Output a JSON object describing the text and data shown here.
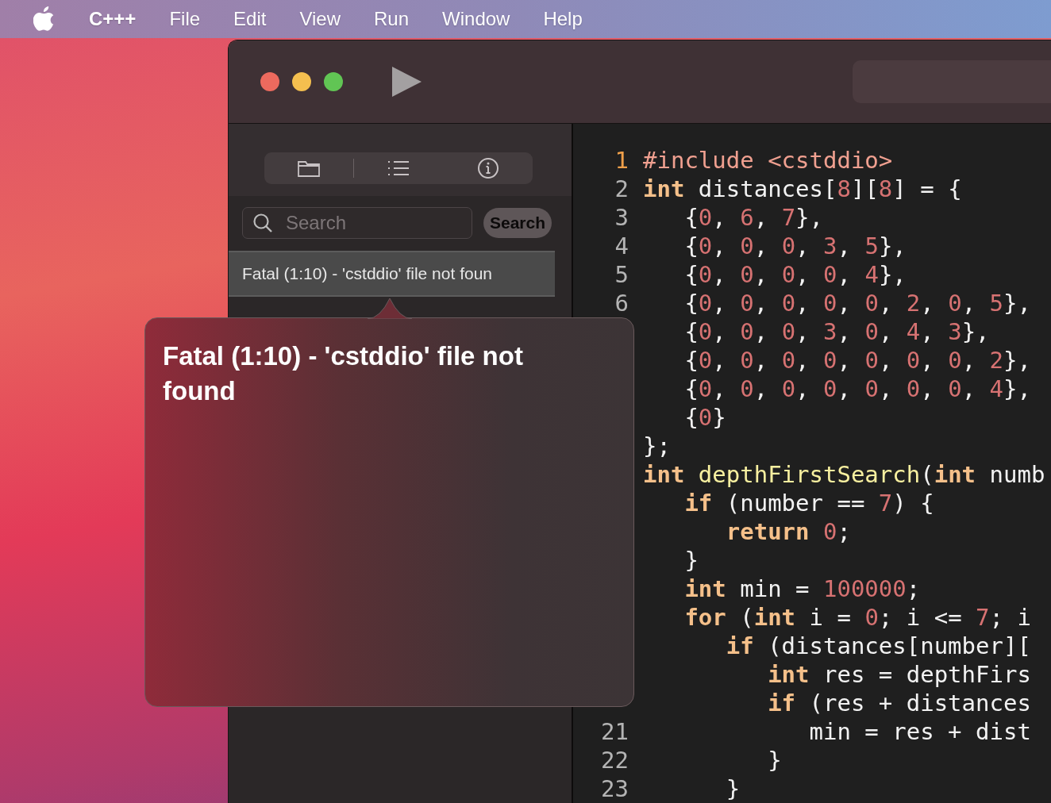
{
  "menu_bar": {
    "app": "C+++",
    "items": [
      "File",
      "Edit",
      "View",
      "Run",
      "Window",
      "Help"
    ]
  },
  "sidebar": {
    "search": {
      "placeholder": "Search",
      "button": "Search"
    },
    "issues": [
      {
        "text": "Fatal (1:10) - 'cstddio' file not foun",
        "selected": true
      }
    ]
  },
  "popover": {
    "message": "Fatal (1:10) - 'cstddio' file not found"
  },
  "editor": {
    "lines": [
      {
        "number": {
          "text": "1",
          "current": true
        },
        "tokens": [
          {
            "kind": "pre",
            "text": "#include <cstddio>"
          }
        ]
      },
      {
        "number": {
          "text": "2",
          "current": false
        },
        "tokens": [
          {
            "kind": "kw",
            "text": "int"
          },
          {
            "kind": "plain",
            "text": " distances["
          },
          {
            "kind": "num",
            "text": "8"
          },
          {
            "kind": "plain",
            "text": "]["
          },
          {
            "kind": "num",
            "text": "8"
          },
          {
            "kind": "plain",
            "text": "] = {"
          }
        ]
      },
      {
        "number": {
          "text": "3",
          "current": false
        },
        "tokens": [
          {
            "kind": "plain",
            "text": "   {"
          },
          {
            "kind": "num",
            "text": "0"
          },
          {
            "kind": "plain",
            "text": ", "
          },
          {
            "kind": "num",
            "text": "6"
          },
          {
            "kind": "plain",
            "text": ", "
          },
          {
            "kind": "num",
            "text": "7"
          },
          {
            "kind": "plain",
            "text": "},"
          }
        ]
      },
      {
        "number": {
          "text": "4",
          "current": false
        },
        "tokens": [
          {
            "kind": "plain",
            "text": "   {"
          },
          {
            "kind": "num",
            "text": "0"
          },
          {
            "kind": "plain",
            "text": ", "
          },
          {
            "kind": "num",
            "text": "0"
          },
          {
            "kind": "plain",
            "text": ", "
          },
          {
            "kind": "num",
            "text": "0"
          },
          {
            "kind": "plain",
            "text": ", "
          },
          {
            "kind": "num",
            "text": "3"
          },
          {
            "kind": "plain",
            "text": ", "
          },
          {
            "kind": "num",
            "text": "5"
          },
          {
            "kind": "plain",
            "text": "},"
          }
        ]
      },
      {
        "number": {
          "text": "5",
          "current": false
        },
        "tokens": [
          {
            "kind": "plain",
            "text": "   {"
          },
          {
            "kind": "num",
            "text": "0"
          },
          {
            "kind": "plain",
            "text": ", "
          },
          {
            "kind": "num",
            "text": "0"
          },
          {
            "kind": "plain",
            "text": ", "
          },
          {
            "kind": "num",
            "text": "0"
          },
          {
            "kind": "plain",
            "text": ", "
          },
          {
            "kind": "num",
            "text": "0"
          },
          {
            "kind": "plain",
            "text": ", "
          },
          {
            "kind": "num",
            "text": "4"
          },
          {
            "kind": "plain",
            "text": "},"
          }
        ]
      },
      {
        "number": {
          "text": "6",
          "current": false
        },
        "tokens": [
          {
            "kind": "plain",
            "text": "   {"
          },
          {
            "kind": "num",
            "text": "0"
          },
          {
            "kind": "plain",
            "text": ", "
          },
          {
            "kind": "num",
            "text": "0"
          },
          {
            "kind": "plain",
            "text": ", "
          },
          {
            "kind": "num",
            "text": "0"
          },
          {
            "kind": "plain",
            "text": ", "
          },
          {
            "kind": "num",
            "text": "0"
          },
          {
            "kind": "plain",
            "text": ", "
          },
          {
            "kind": "num",
            "text": "0"
          },
          {
            "kind": "plain",
            "text": ", "
          },
          {
            "kind": "num",
            "text": "2"
          },
          {
            "kind": "plain",
            "text": ", "
          },
          {
            "kind": "num",
            "text": "0"
          },
          {
            "kind": "plain",
            "text": ", "
          },
          {
            "kind": "num",
            "text": "5"
          },
          {
            "kind": "plain",
            "text": "},"
          }
        ]
      },
      {
        "tokens": [
          {
            "kind": "plain",
            "text": "   {"
          },
          {
            "kind": "num",
            "text": "0"
          },
          {
            "kind": "plain",
            "text": ", "
          },
          {
            "kind": "num",
            "text": "0"
          },
          {
            "kind": "plain",
            "text": ", "
          },
          {
            "kind": "num",
            "text": "0"
          },
          {
            "kind": "plain",
            "text": ", "
          },
          {
            "kind": "num",
            "text": "3"
          },
          {
            "kind": "plain",
            "text": ", "
          },
          {
            "kind": "num",
            "text": "0"
          },
          {
            "kind": "plain",
            "text": ", "
          },
          {
            "kind": "num",
            "text": "4"
          },
          {
            "kind": "plain",
            "text": ", "
          },
          {
            "kind": "num",
            "text": "3"
          },
          {
            "kind": "plain",
            "text": "},"
          }
        ]
      },
      {
        "tokens": [
          {
            "kind": "plain",
            "text": "   {"
          },
          {
            "kind": "num",
            "text": "0"
          },
          {
            "kind": "plain",
            "text": ", "
          },
          {
            "kind": "num",
            "text": "0"
          },
          {
            "kind": "plain",
            "text": ", "
          },
          {
            "kind": "num",
            "text": "0"
          },
          {
            "kind": "plain",
            "text": ", "
          },
          {
            "kind": "num",
            "text": "0"
          },
          {
            "kind": "plain",
            "text": ", "
          },
          {
            "kind": "num",
            "text": "0"
          },
          {
            "kind": "plain",
            "text": ", "
          },
          {
            "kind": "num",
            "text": "0"
          },
          {
            "kind": "plain",
            "text": ", "
          },
          {
            "kind": "num",
            "text": "0"
          },
          {
            "kind": "plain",
            "text": ", "
          },
          {
            "kind": "num",
            "text": "2"
          },
          {
            "kind": "plain",
            "text": "},"
          }
        ]
      },
      {
        "tokens": [
          {
            "kind": "plain",
            "text": "   {"
          },
          {
            "kind": "num",
            "text": "0"
          },
          {
            "kind": "plain",
            "text": ", "
          },
          {
            "kind": "num",
            "text": "0"
          },
          {
            "kind": "plain",
            "text": ", "
          },
          {
            "kind": "num",
            "text": "0"
          },
          {
            "kind": "plain",
            "text": ", "
          },
          {
            "kind": "num",
            "text": "0"
          },
          {
            "kind": "plain",
            "text": ", "
          },
          {
            "kind": "num",
            "text": "0"
          },
          {
            "kind": "plain",
            "text": ", "
          },
          {
            "kind": "num",
            "text": "0"
          },
          {
            "kind": "plain",
            "text": ", "
          },
          {
            "kind": "num",
            "text": "0"
          },
          {
            "kind": "plain",
            "text": ", "
          },
          {
            "kind": "num",
            "text": "4"
          },
          {
            "kind": "plain",
            "text": "},"
          }
        ]
      },
      {
        "tokens": [
          {
            "kind": "plain",
            "text": "   {"
          },
          {
            "kind": "num",
            "text": "0"
          },
          {
            "kind": "plain",
            "text": "}"
          }
        ]
      },
      {
        "tokens": [
          {
            "kind": "plain",
            "text": "};"
          }
        ]
      },
      {
        "tokens": [
          {
            "kind": "kw",
            "text": "int"
          },
          {
            "kind": "fn",
            "text": " depthFirstSearch"
          },
          {
            "kind": "plain",
            "text": "("
          },
          {
            "kind": "kw",
            "text": "int"
          },
          {
            "kind": "plain",
            "text": " numb"
          }
        ]
      },
      {
        "tokens": [
          {
            "kind": "kw",
            "text": "   if"
          },
          {
            "kind": "plain",
            "text": " (number == "
          },
          {
            "kind": "num",
            "text": "7"
          },
          {
            "kind": "plain",
            "text": ") {"
          }
        ]
      },
      {
        "tokens": [
          {
            "kind": "kw",
            "text": "      return"
          },
          {
            "kind": "num",
            "text": " 0"
          },
          {
            "kind": "plain",
            "text": ";"
          }
        ]
      },
      {
        "tokens": [
          {
            "kind": "plain",
            "text": "   }"
          }
        ]
      },
      {
        "tokens": [
          {
            "kind": "kw",
            "text": "   int"
          },
          {
            "kind": "plain",
            "text": " min = "
          },
          {
            "kind": "num",
            "text": "100000"
          },
          {
            "kind": "plain",
            "text": ";"
          }
        ]
      },
      {
        "tokens": [
          {
            "kind": "kw",
            "text": "   for"
          },
          {
            "kind": "plain",
            "text": " ("
          },
          {
            "kind": "kw",
            "text": "int"
          },
          {
            "kind": "plain",
            "text": " i = "
          },
          {
            "kind": "num",
            "text": "0"
          },
          {
            "kind": "plain",
            "text": "; i <= "
          },
          {
            "kind": "num",
            "text": "7"
          },
          {
            "kind": "plain",
            "text": "; i"
          }
        ]
      },
      {
        "tokens": [
          {
            "kind": "kw",
            "text": "      if"
          },
          {
            "kind": "plain",
            "text": " (distances[number]["
          }
        ]
      },
      {
        "tokens": [
          {
            "kind": "kw",
            "text": "         int"
          },
          {
            "kind": "plain",
            "text": " res = depthFirs"
          }
        ]
      },
      {
        "tokens": [
          {
            "kind": "kw",
            "text": "         if"
          },
          {
            "kind": "plain",
            "text": " (res + distances"
          }
        ]
      },
      {
        "number": {
          "text": "21",
          "current": false
        },
        "tokens": [
          {
            "kind": "plain",
            "text": "            min = res + dist"
          }
        ]
      },
      {
        "number": {
          "text": "22",
          "current": false
        },
        "tokens": [
          {
            "kind": "plain",
            "text": "         }"
          }
        ]
      },
      {
        "number": {
          "text": "23",
          "current": false
        },
        "tokens": [
          {
            "kind": "plain",
            "text": "      }"
          }
        ]
      }
    ]
  }
}
